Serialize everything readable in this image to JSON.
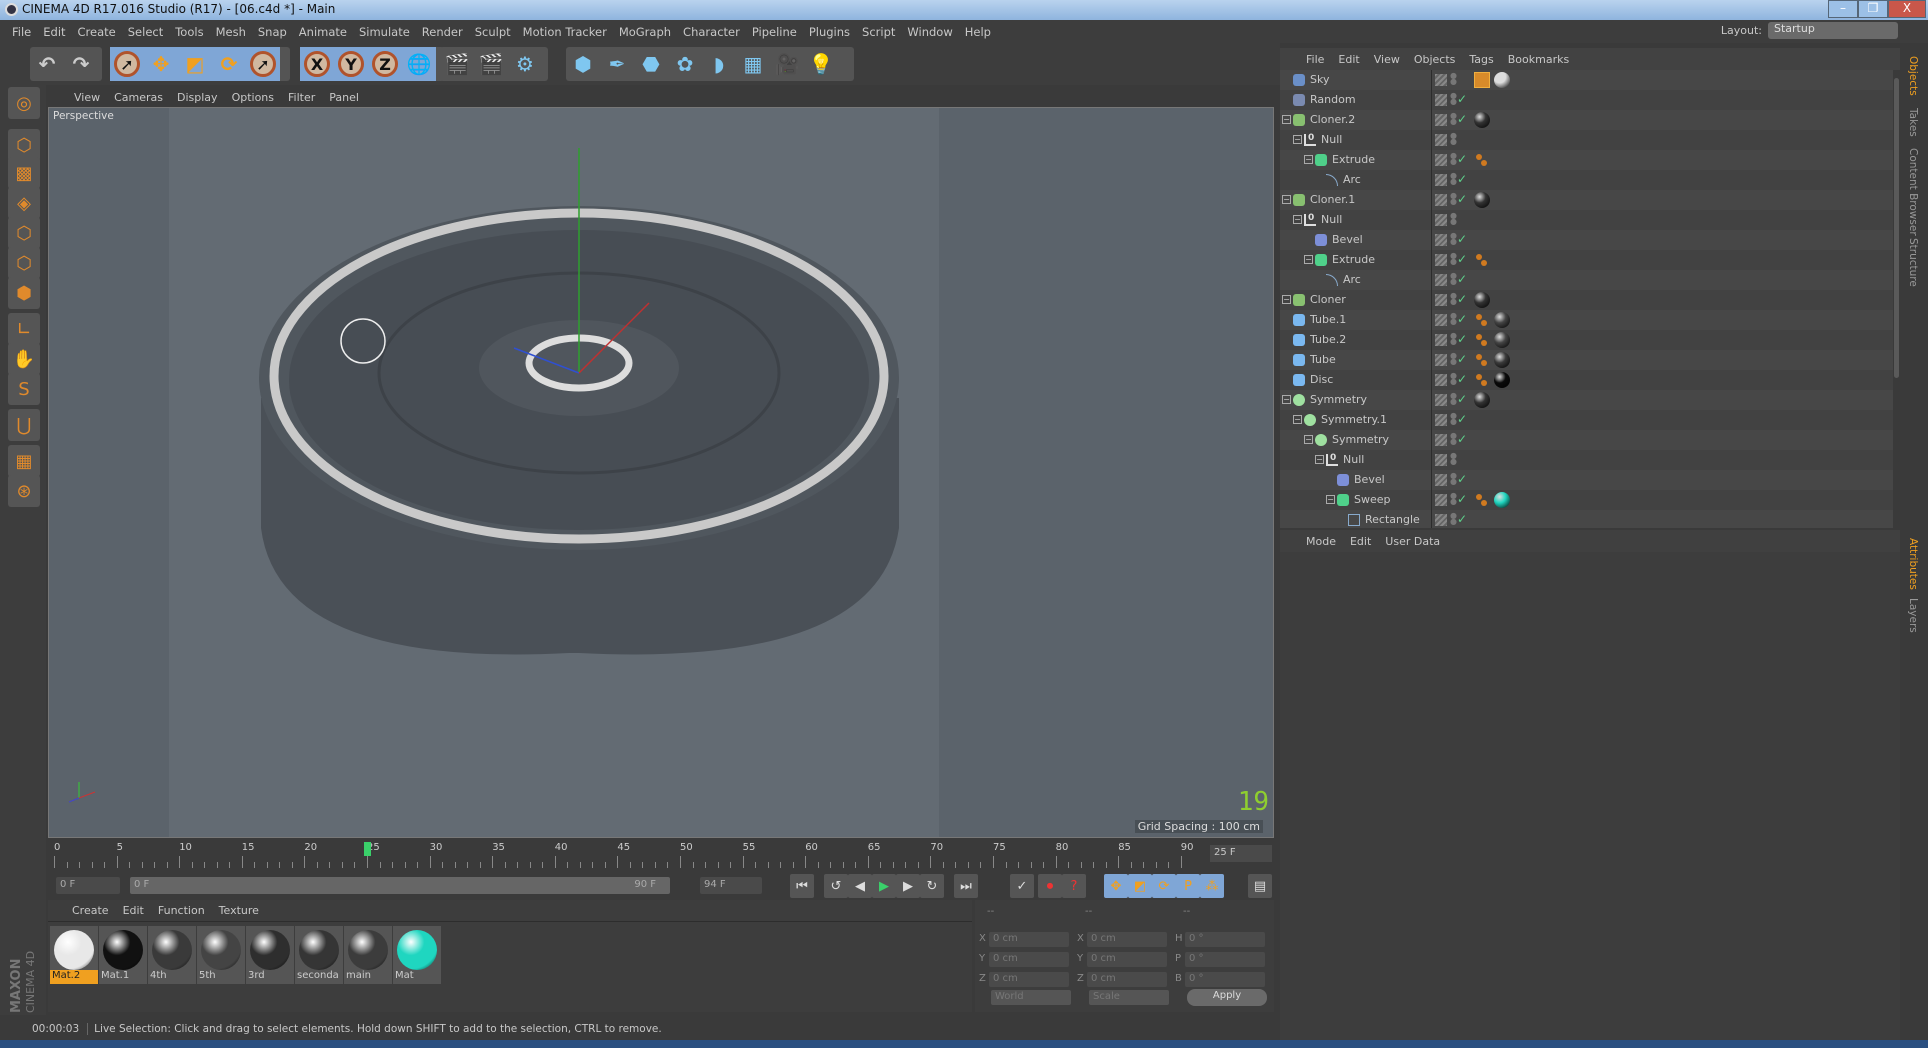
{
  "window": {
    "title": "CINEMA 4D R17.016 Studio (R17) - [06.c4d *] - Main",
    "min": "–",
    "restore": "❐",
    "close": "X"
  },
  "menu": [
    "File",
    "Edit",
    "Create",
    "Select",
    "Tools",
    "Mesh",
    "Snap",
    "Animate",
    "Simulate",
    "Render",
    "Sculpt",
    "Motion Tracker",
    "MoGraph",
    "Character",
    "Pipeline",
    "Plugins",
    "Script",
    "Window",
    "Help"
  ],
  "layout": {
    "label": "Layout:",
    "value": "Startup"
  },
  "toolbar": {
    "icons": [
      "undo-icon",
      "redo-icon",
      "live-selection-icon",
      "move-icon",
      "scale-icon",
      "rotate-icon",
      "recent-tool-icon",
      "x-axis-icon",
      "y-axis-icon",
      "z-axis-icon",
      "world-coordinates-icon",
      "render-view-icon",
      "render-picture-viewer-icon",
      "render-settings-icon",
      "cube-icon",
      "pen-icon",
      "subdivision-icon",
      "cloner-icon",
      "deformer-icon",
      "floor-icon",
      "camera-icon",
      "light-icon"
    ],
    "x": "X",
    "y": "Y",
    "z": "Z"
  },
  "viewport": {
    "menu": [
      "View",
      "Cameras",
      "Display",
      "Options",
      "Filter",
      "Panel"
    ],
    "name": "Perspective",
    "grid_spacing": "Grid Spacing : 100 cm",
    "fps": "19"
  },
  "timeline": {
    "ticks": [
      "0",
      "5",
      "10",
      "15",
      "20",
      "25",
      "30",
      "35",
      "40",
      "45",
      "50",
      "55",
      "60",
      "65",
      "70",
      "75",
      "80",
      "85",
      "90"
    ],
    "current_frame": 25,
    "frame_field": "25 F",
    "start": "0 F",
    "range_start": "0 F",
    "range_end": "90 F",
    "end": "94 F"
  },
  "materials": {
    "menu": [
      "Create",
      "Edit",
      "Function",
      "Texture"
    ],
    "items": [
      {
        "name": "Mat.2",
        "color": "#e8e8e8",
        "selected": true
      },
      {
        "name": "Mat.1",
        "color": "#111111"
      },
      {
        "name": "4th",
        "color": "#3a3a3a"
      },
      {
        "name": "5th",
        "color": "#444444"
      },
      {
        "name": "3rd",
        "color": "#2e2e2e"
      },
      {
        "name": "seconda",
        "color": "#353535"
      },
      {
        "name": "main",
        "color": "#3c3c3c"
      },
      {
        "name": "Mat",
        "color": "#1fd6c0"
      }
    ]
  },
  "coords": {
    "headers": [
      "--",
      "--",
      "--"
    ],
    "rows": [
      {
        "a": "X",
        "av": "0 cm",
        "b": "X",
        "bv": "0 cm",
        "c": "H",
        "cv": "0 °"
      },
      {
        "a": "Y",
        "av": "0 cm",
        "b": "Y",
        "bv": "0 cm",
        "c": "P",
        "cv": "0 °"
      },
      {
        "a": "Z",
        "av": "0 cm",
        "b": "Z",
        "bv": "0 cm",
        "c": "B",
        "cv": "0 °"
      }
    ],
    "world": "World",
    "scale": "Scale",
    "apply": "Apply"
  },
  "status": {
    "time": "00:00:03",
    "message": "Live Selection: Click and drag to select elements. Hold down SHIFT to add to the selection, CTRL to remove."
  },
  "objects": {
    "menu": [
      "File",
      "Edit",
      "View",
      "Objects",
      "Tags",
      "Bookmarks"
    ],
    "items": [
      {
        "name": "Sky",
        "level": 0,
        "icon": "#6a8fc8",
        "check": false,
        "tags": [
          "#d88b2a",
          "#dddddd"
        ]
      },
      {
        "name": "Random",
        "level": 0,
        "icon": "#7a8ab0",
        "check": true,
        "tags": []
      },
      {
        "name": "Cloner.2",
        "level": 0,
        "icon": "#88c070",
        "exp": true,
        "check": true,
        "tags": [
          "#333333"
        ]
      },
      {
        "name": "Null",
        "level": 1,
        "icon": "null",
        "exp": true,
        "check": false,
        "tags": []
      },
      {
        "name": "Extrude",
        "level": 2,
        "icon": "#4fd08a",
        "exp": true,
        "check": true,
        "tags": [
          "phong"
        ]
      },
      {
        "name": "Arc",
        "level": 3,
        "icon": "arc",
        "check": true,
        "tags": []
      },
      {
        "name": "Cloner.1",
        "level": 0,
        "icon": "#88c070",
        "exp": true,
        "check": true,
        "tags": [
          "#333333"
        ]
      },
      {
        "name": "Null",
        "level": 1,
        "icon": "null",
        "exp": true,
        "check": false,
        "tags": []
      },
      {
        "name": "Bevel",
        "level": 2,
        "icon": "#7d8fd8",
        "check": true,
        "tags": []
      },
      {
        "name": "Extrude",
        "level": 2,
        "icon": "#4fd08a",
        "exp": true,
        "check": true,
        "tags": [
          "phong"
        ]
      },
      {
        "name": "Arc",
        "level": 3,
        "icon": "arc",
        "check": true,
        "tags": []
      },
      {
        "name": "Cloner",
        "level": 0,
        "icon": "#88c070",
        "exp": true,
        "check": true,
        "tags": [
          "#333333"
        ]
      },
      {
        "name": "Tube.1",
        "level": 0,
        "icon": "#7ab8f0",
        "check": true,
        "tags": [
          "phong",
          "#444444"
        ]
      },
      {
        "name": "Tube.2",
        "level": 0,
        "icon": "#7ab8f0",
        "check": true,
        "tags": [
          "phong",
          "#444444"
        ]
      },
      {
        "name": "Tube",
        "level": 0,
        "icon": "#7ab8f0",
        "check": true,
        "tags": [
          "phong",
          "#3a3a3a"
        ]
      },
      {
        "name": "Disc",
        "level": 0,
        "icon": "#7ab8f0",
        "check": true,
        "tags": [
          "phong",
          "#0a0a0a"
        ]
      },
      {
        "name": "Symmetry",
        "level": 0,
        "icon": "#9fe0a0",
        "exp": true,
        "check": true,
        "tags": [
          "#333333"
        ]
      },
      {
        "name": "Symmetry.1",
        "level": 1,
        "icon": "#9fe0a0",
        "exp": true,
        "check": true,
        "tags": []
      },
      {
        "name": "Symmetry",
        "level": 2,
        "icon": "#9fe0a0",
        "exp": true,
        "check": true,
        "tags": []
      },
      {
        "name": "Null",
        "level": 3,
        "icon": "null",
        "exp": true,
        "check": false,
        "tags": []
      },
      {
        "name": "Bevel",
        "level": 4,
        "icon": "#7d8fd8",
        "check": true,
        "tags": []
      },
      {
        "name": "Sweep",
        "level": 4,
        "icon": "#4fd08a",
        "exp": true,
        "check": true,
        "tags": [
          "phong",
          "#1fd6c0"
        ]
      },
      {
        "name": "Rectangle",
        "level": 5,
        "icon": "rect",
        "check": true,
        "tags": []
      }
    ]
  },
  "attributes": {
    "menu": [
      "Mode",
      "Edit",
      "User Data"
    ]
  },
  "side_tabs": [
    "Objects",
    "Takes",
    "Content Browser",
    "Structure"
  ],
  "side_tabs2": [
    "Attributes",
    "Layers"
  ],
  "brand": "MAXON CINEMA 4D"
}
